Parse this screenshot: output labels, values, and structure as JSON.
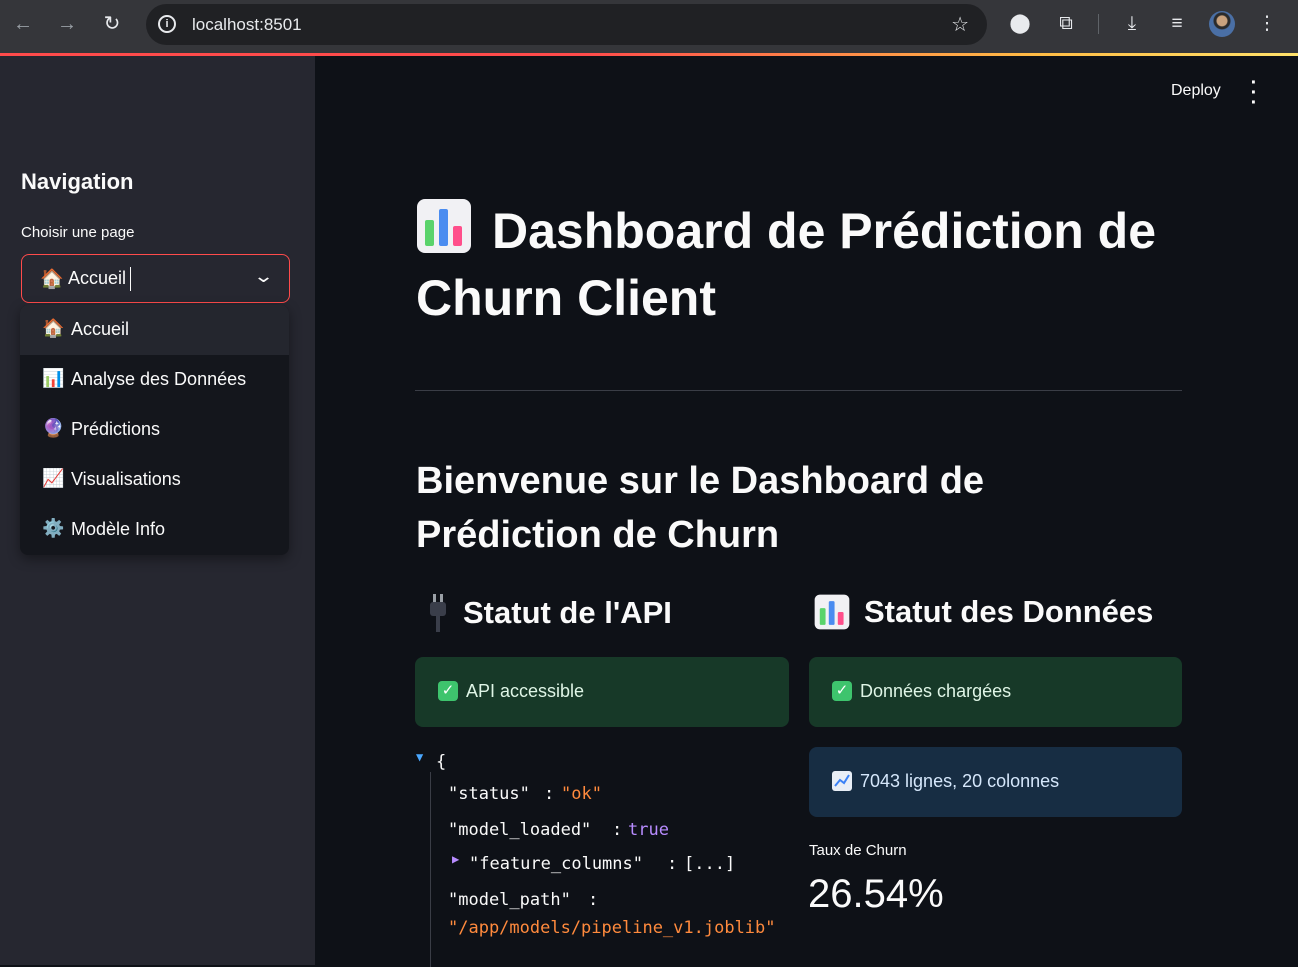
{
  "browser": {
    "url": "localhost:8501",
    "icons": [
      "back-icon",
      "forward-icon",
      "reload-icon",
      "site-info-icon",
      "bookmark-star-icon",
      "extension-puzzle-icon",
      "extensions-icon",
      "download-icon",
      "media-queue-icon",
      "profile-avatar",
      "more-menu-icon"
    ]
  },
  "sidebar": {
    "title": "Navigation",
    "select_label": "Choisir une page",
    "select_value": "Accueil",
    "select_emoji": "🏠",
    "options": [
      {
        "emoji": "🏠",
        "label": "Accueil"
      },
      {
        "emoji": "📊",
        "label": "Analyse des Données"
      },
      {
        "emoji": "🔮",
        "label": "Prédictions"
      },
      {
        "emoji": "📈",
        "label": "Visualisations"
      },
      {
        "emoji": "⚙️",
        "label": "Modèle Info"
      }
    ]
  },
  "header": {
    "deploy_label": "Deploy"
  },
  "main": {
    "title": "Dashboard de Prédiction de Churn Client",
    "welcome": "Bienvenue sur le Dashboard de Prédiction de Churn",
    "api_heading": "Statut de l'API",
    "data_heading": "Statut des Données",
    "api_status": "API accessible",
    "data_status": "Données chargées",
    "data_info": "7043 lignes, 20 colonnes",
    "metric_label": "Taux de Churn",
    "metric_value": "26.54%"
  },
  "json_view": {
    "open_brace": "{",
    "status_key": "\"status\"",
    "status_val": "\"ok\"",
    "model_loaded_key": "\"model_loaded\"",
    "model_loaded_val": "true",
    "feature_columns_key": "\"feature_columns\"",
    "feature_columns_val": "[...]",
    "model_path_key": "\"model_path\"",
    "model_path_val": "\"/app/models/pipeline_v1.joblib\"",
    "colon": ":"
  },
  "colors": {
    "accent": "#ff4b4b",
    "success_bg": "#173928",
    "info_bg": "#172d43",
    "json_string": "#ff8a3d",
    "json_bool": "#b88cff"
  }
}
